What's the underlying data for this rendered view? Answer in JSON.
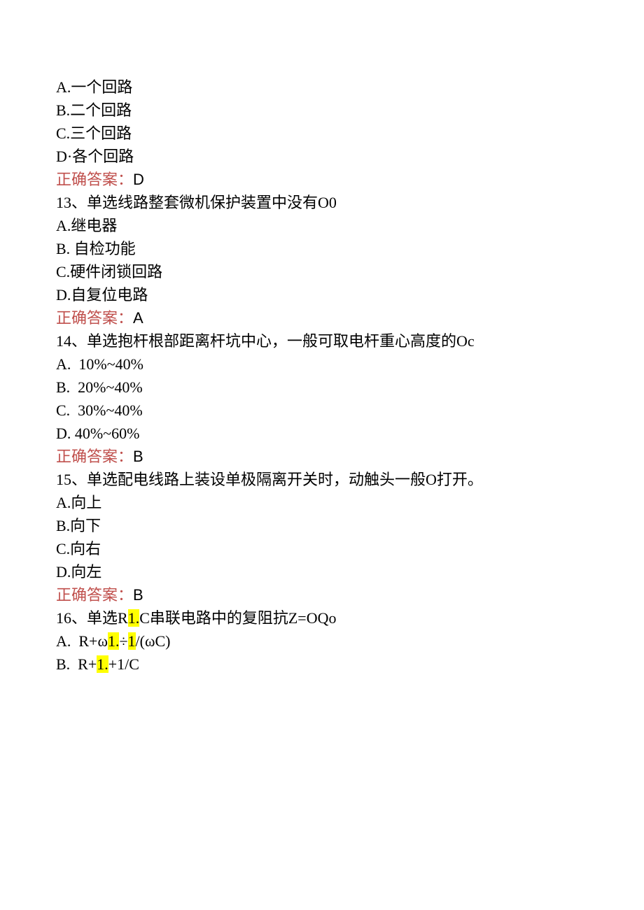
{
  "q12": {
    "opt_a": "A.一个回路",
    "opt_b": "B.二个回路",
    "opt_c": "C.三个回路",
    "opt_d": "D·各个回路",
    "answer_label": "正确答案：",
    "answer_value": "D"
  },
  "q13": {
    "stem": "13、单选线路整套微机保护装置中没有O0",
    "opt_a": "A.继电器",
    "opt_b": "B. 自检功能",
    "opt_c": "C.硬件闭锁回路",
    "opt_d": "D.自复位电路",
    "answer_label": "正确答案：",
    "answer_value": "A"
  },
  "q14": {
    "stem": "14、单选抱杆根部距离杆坑中心，一般可取电杆重心高度的Oc",
    "opt_a": "A.  10%~40%",
    "opt_b": "B.  20%~40%",
    "opt_c": "C.  30%~40%",
    "opt_d": "D. 40%~60%",
    "answer_label": "正确答案：",
    "answer_value": "B"
  },
  "q15": {
    "stem": "15、单选配电线路上装设单极隔离开关时，动触头一般O打开。",
    "opt_a": "A.向上",
    "opt_b": "B.向下",
    "opt_c": "C.向右",
    "opt_d": "D.向左",
    "answer_label": "正确答案：",
    "answer_value": "B"
  },
  "q16": {
    "stem_pre": "16、单选R",
    "stem_hl": "1.",
    "stem_post": "C串联电路中的复阻抗Z=OQo",
    "a_pre": "A.  R+ω",
    "a_hl1": "1.",
    "a_mid": "÷",
    "a_hl2": "1",
    "a_post": "/(ωC)",
    "b_pre": "B.  R+",
    "b_hl": "1.",
    "b_post": "+1/C"
  }
}
